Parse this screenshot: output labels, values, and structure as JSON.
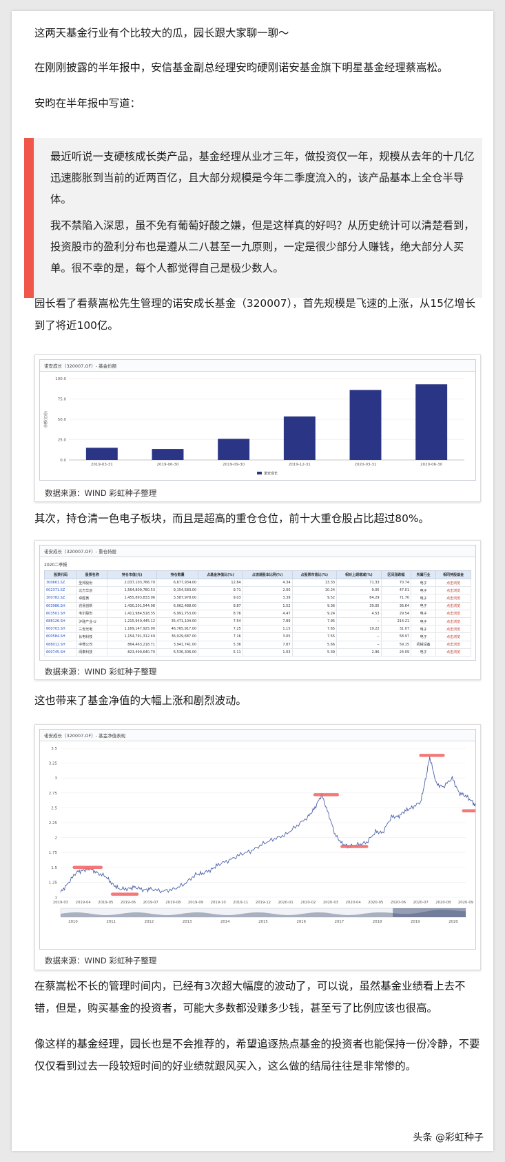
{
  "paragraphs": {
    "p1": "这两天基金行业有个比较大的瓜，园长跟大家聊一聊～",
    "p2": "在刚刚披露的半年报中，安信基金副总经理安昀硬刚诺安基金旗下明星基金经理蔡嵩松。",
    "p3": "安昀在半年报中写道：",
    "quote1": "最近听说一支硬核成长类产品，基金经理从业才三年，做投资仅一年，规模从去年的十几亿迅速膨胀到当前的近两百亿，且大部分规模是今年二季度流入的，该产品基本上全仓半导体。",
    "quote2": "我不禁陷入深思，虽不免有葡萄好酸之嫌，但是这样真的好吗？从历史统计可以清楚看到，投资股市的盈利分布也是遵从二八甚至一九原则，一定是很少部分人赚钱，绝大部分人买单。很不幸的是，每个人都觉得自己是极少数人。",
    "p4": "园长看了看蔡嵩松先生管理的诺安成长基金（320007），首先规模是飞速的上涨，从15亿增长到了将近100亿。",
    "p5": "其次，持仓清一色电子板块，而且是超高的重仓仓位，前十大重仓股占比超过80%。",
    "p6": "这也带来了基金净值的大幅上涨和剧烈波动。",
    "p7": "在蔡嵩松不长的管理时间内，已经有3次超大幅度的波动了，可以说，虽然基金业绩看上去不错，但是，购买基金的投资者，可能大多数都没赚多少钱，甚至亏了比例应该也很高。",
    "p8": "像这样的基金经理，园长也是不会推荐的，希望追逐热点基金的投资者也能保持一份冷静，不要仅仅看到过去一段较短时间的好业绩就跟风买入，这么做的结局往往是非常惨的。"
  },
  "source_label": "数据来源：WIND 彩虹种子整理",
  "watermark": "头条 @彩虹种子",
  "table": {
    "title": "诺安成长（320007.OF）- 重仓持股",
    "period": "2020二季报",
    "headers": [
      "股票代码",
      "股票名称",
      "持仓市值(元)",
      "持仓数量",
      "占基金净值比(%)",
      "占流通股本比例(%)",
      "占股票市值比(%)",
      "相对上期增减(%)",
      "区间涨跌幅",
      "所属行业",
      "相同持股基金"
    ],
    "rows": [
      [
        "300661.SZ",
        "圣邦股份",
        "2,037,103,766.70",
        "6,677,934.00",
        "12.84",
        "4.34",
        "13.33",
        "71.33",
        "70.74",
        "电子",
        "点击浏览"
      ],
      [
        "002371.SZ",
        "北方华创",
        "1,564,809,780.53",
        "9,154,583.00",
        "9.71",
        "2.00",
        "10.24",
        "9.05",
        "47.01",
        "电子",
        "点击浏览"
      ],
      [
        "300782.SZ",
        "卓胜微",
        "1,455,893,833.06",
        "3,587,978.00",
        "9.03",
        "3.39",
        "9.52",
        "84.29",
        "71.70",
        "电子",
        "点击浏览"
      ],
      [
        "603986.SH",
        "兆易创新",
        "1,430,201,544.08",
        "6,062,488.00",
        "8.87",
        "1.52",
        "9.36",
        "39.05",
        "36.64",
        "电子",
        "点击浏览"
      ],
      [
        "603501.SH",
        "韦尔股份",
        "1,411,984,518.35",
        "6,991,753.00",
        "8.76",
        "4.47",
        "9.24",
        "4.53",
        "29.54",
        "电子",
        "点击浏览"
      ],
      [
        "688126.SH",
        "沪硅产业-U",
        "1,215,949,445.12",
        "35,471,104.00",
        "7.54",
        "7.89",
        "7.95",
        "--",
        "214.21",
        "电子",
        "点击浏览"
      ],
      [
        "600703.SH",
        "三安光电",
        "1,169,147,925.00",
        "46,765,917.00",
        "7.25",
        "1.15",
        "7.65",
        "19.22",
        "31.07",
        "电子",
        "点击浏览"
      ],
      [
        "600584.SH",
        "长电科技",
        "1,154,791,312.49",
        "36,929,687.00",
        "7.16",
        "3.05",
        "7.55",
        "--",
        "58.97",
        "电子",
        "点击浏览"
      ],
      [
        "688012.SH",
        "中微公司",
        "864,463,218.71",
        "3,941,741.00",
        "5.36",
        "7.87",
        "5.66",
        "--",
        "59.15",
        "机械设备",
        "点击浏览"
      ],
      [
        "600745.SH",
        "闻泰科技",
        "823,499,640.70",
        "6,536,306.00",
        "5.11",
        "1.03",
        "5.39",
        "2.96",
        "24.09",
        "电子",
        "点击浏览"
      ]
    ]
  },
  "chart_data": [
    {
      "type": "bar",
      "title": "诺安成长（320007.OF）- 基金份额",
      "ylabel": "份额(亿份)",
      "categories": [
        "2019-03-31",
        "2019-06-30",
        "2019-09-30",
        "2019-12-31",
        "2020-03-31",
        "2020-06-30"
      ],
      "series": [
        {
          "name": "诺安成长",
          "values": [
            15,
            13.5,
            26,
            53.5,
            86,
            93
          ]
        }
      ],
      "yticks": [
        "0.0",
        "25.0",
        "50.0",
        "75.0",
        "100.0"
      ],
      "ylim": [
        0,
        100
      ],
      "bar_color": "#2a3585",
      "legend": "bottom"
    },
    {
      "type": "line",
      "title": "诺安成长（320007.OF）- 基金净值表现",
      "xticks": [
        "2019-03",
        "2019-04",
        "2019-05",
        "2019-06",
        "2019-07",
        "2019-08",
        "2019-09",
        "2019-10",
        "2019-11",
        "2019-12",
        "2020-01",
        "2020-02",
        "2020-03",
        "2020-04",
        "2020-05",
        "2020-06",
        "2020-07",
        "2020-08",
        "2020-09"
      ],
      "yticks": [
        "1",
        "1.25",
        "1.5",
        "1.75",
        "2",
        "2.25",
        "2.5",
        "2.75",
        "3",
        "3.25",
        "3.5"
      ],
      "ylim": [
        1,
        3.5
      ],
      "navigator_years": [
        "2010",
        "2011",
        "2012",
        "2013",
        "2014",
        "2015",
        "2016",
        "2017",
        "2018",
        "2019",
        "2020"
      ],
      "anchors": [
        [
          0,
          1.08
        ],
        [
          0.3,
          1.22
        ],
        [
          0.7,
          1.42
        ],
        [
          1.0,
          1.45
        ],
        [
          1.3,
          1.48
        ],
        [
          1.6,
          1.41
        ],
        [
          2.0,
          1.35
        ],
        [
          2.3,
          1.22
        ],
        [
          2.6,
          1.14
        ],
        [
          3.0,
          1.14
        ],
        [
          3.3,
          1.17
        ],
        [
          3.7,
          1.12
        ],
        [
          4.0,
          1.14
        ],
        [
          4.5,
          1.1
        ],
        [
          5.0,
          1.13
        ],
        [
          5.5,
          1.22
        ],
        [
          6.0,
          1.38
        ],
        [
          6.3,
          1.4
        ],
        [
          6.7,
          1.46
        ],
        [
          7.0,
          1.55
        ],
        [
          7.5,
          1.62
        ],
        [
          8.0,
          1.72
        ],
        [
          8.5,
          1.78
        ],
        [
          9.0,
          1.9
        ],
        [
          9.5,
          1.98
        ],
        [
          10.0,
          2.05
        ],
        [
          10.5,
          2.2
        ],
        [
          11.0,
          2.35
        ],
        [
          11.3,
          2.5
        ],
        [
          11.6,
          2.72
        ],
        [
          11.9,
          2.4
        ],
        [
          12.2,
          2.05
        ],
        [
          12.5,
          1.9
        ],
        [
          12.8,
          1.85
        ],
        [
          13.2,
          1.88
        ],
        [
          13.6,
          1.92
        ],
        [
          14.0,
          2.1
        ],
        [
          14.3,
          2.08
        ],
        [
          14.7,
          2.35
        ],
        [
          15.0,
          2.35
        ],
        [
          15.3,
          2.45
        ],
        [
          15.6,
          2.5
        ],
        [
          16.0,
          2.6
        ],
        [
          16.2,
          2.95
        ],
        [
          16.4,
          3.35
        ],
        [
          16.7,
          2.9
        ],
        [
          17.0,
          2.85
        ],
        [
          17.4,
          3.0
        ],
        [
          17.7,
          2.75
        ],
        [
          18.0,
          2.7
        ],
        [
          18.3,
          2.6
        ],
        [
          18.5,
          2.48
        ]
      ],
      "color": "#4a5fa8",
      "highlight_color": "#f26b6b",
      "highlights": [
        {
          "x0": 0.6,
          "x1": 1.8,
          "y": 1.5
        },
        {
          "x0": 2.3,
          "x1": 3.4,
          "y": 1.05
        },
        {
          "x0": 11.3,
          "x1": 12.3,
          "y": 2.72
        },
        {
          "x0": 12.5,
          "x1": 13.6,
          "y": 1.85
        },
        {
          "x0": 16.0,
          "x1": 17.0,
          "y": 3.38
        },
        {
          "x0": 17.9,
          "x1": 18.8,
          "y": 2.45
        }
      ]
    }
  ]
}
